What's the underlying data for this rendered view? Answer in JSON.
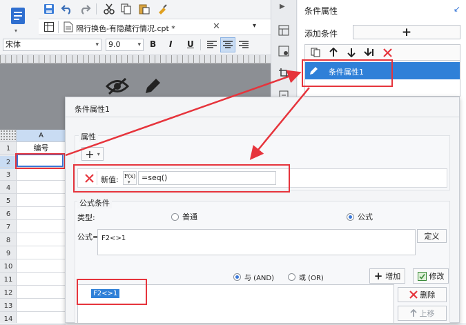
{
  "toolbar": {
    "tab_title": "隔行换色-有隐藏行情况.cpt *",
    "font_name": "宋体",
    "font_size": "9.0",
    "bold": "B",
    "italic": "I",
    "underline": "U"
  },
  "right_panel": {
    "title": "条件属性",
    "add_condition_label": "添加条件",
    "list_items": [
      "条件属性1"
    ]
  },
  "sheet": {
    "column_header": "A",
    "rows": [
      "1",
      "2",
      "3",
      "4",
      "5",
      "6",
      "7",
      "8",
      "9",
      "10",
      "11",
      "12",
      "13",
      "14"
    ],
    "cell_a1": "编号"
  },
  "dialog": {
    "title": "条件属性1",
    "property_section": "属性",
    "new_value_label": "新值:",
    "fx_label": "F(x)",
    "new_value": "=seq()",
    "formula_section": "公式条件",
    "type_label": "类型:",
    "type_normal": "普通",
    "type_formula": "公式",
    "formula_label": "公式=",
    "formula_value": "F2<>1",
    "define_button": "定义",
    "and_label": "与 (AND)",
    "or_label": "或 (OR)",
    "add_button": "增加",
    "modify_button": "修改",
    "delete_button": "删除",
    "move_up_button": "上移",
    "condition_item": "F2<>1"
  },
  "colors": {
    "accent": "#3a78d8",
    "highlight": "#e6343c",
    "selected_row": "#2f80d8"
  }
}
